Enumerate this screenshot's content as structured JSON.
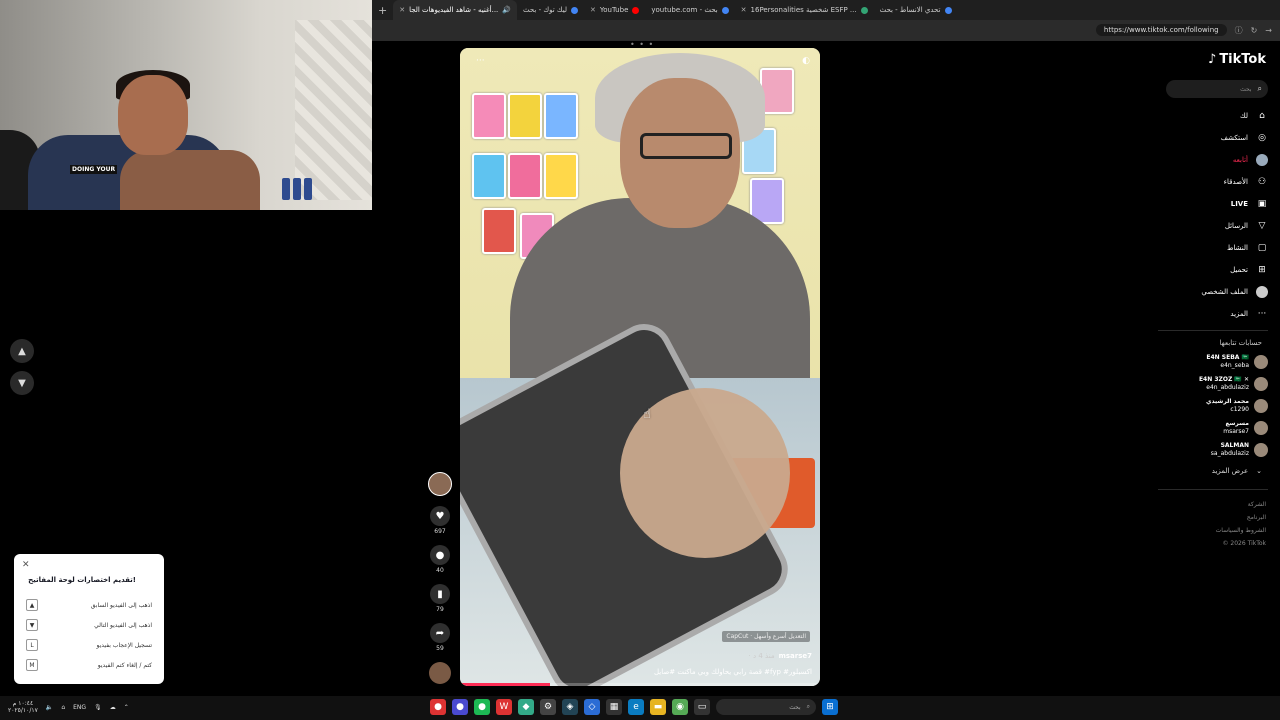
{
  "browser": {
    "tabs": [
      {
        "label": "أغنيه - شاهد الفيديوهات الجا...",
        "active": true,
        "color": "#888888"
      },
      {
        "label": "ليك توك - بحث",
        "active": false,
        "color": "#4285f4"
      },
      {
        "label": "YouTube",
        "active": false,
        "color": "#ff0000"
      },
      {
        "label": "youtube.com - بحث",
        "active": false,
        "color": "#4285f4"
      },
      {
        "label": "16Personalities شخصية ESFP ...",
        "active": false,
        "color": "#33a474"
      },
      {
        "label": "تحدي الانساط - بحث",
        "active": false,
        "color": "#4285f4"
      }
    ],
    "new_tab": "+",
    "url": "https://www.tiktok.com/following"
  },
  "tiktok": {
    "logo": "TikTok",
    "search_placeholder": "بحث",
    "nav": [
      {
        "label": "لك",
        "icon": "home-icon",
        "glyph": "⌂"
      },
      {
        "label": "استكشف",
        "icon": "compass-icon",
        "glyph": "◎"
      },
      {
        "label": "أتابعه",
        "icon": "following-icon",
        "glyph": "●",
        "active": true
      },
      {
        "label": "الأصدقاء",
        "icon": "friends-icon",
        "glyph": "👥"
      },
      {
        "label": "LIVE",
        "icon": "live-icon",
        "glyph": "▣",
        "bold": true
      },
      {
        "label": "الرسائل",
        "icon": "messages-icon",
        "glyph": "▽"
      },
      {
        "label": "النشاط",
        "icon": "activity-icon",
        "glyph": "▢"
      },
      {
        "label": "تحميل",
        "icon": "upload-icon",
        "glyph": "⊞"
      },
      {
        "label": "الملف الشخصي",
        "icon": "profile-icon",
        "glyph": "●"
      },
      {
        "label": "المزيد",
        "icon": "more-icon",
        "glyph": "···"
      }
    ],
    "following_title": "حسابات تتابعها",
    "following": [
      {
        "name": "E4N SEBA 🇸🇦",
        "handle": "e4n_seba"
      },
      {
        "name": "E4N 3ZOZ 🇸🇦 ✕",
        "handle": "e4n_abdulaziz"
      },
      {
        "name": "محمد الرشيدي",
        "handle": "c1290"
      },
      {
        "name": "مسرسع",
        "handle": "msarse7"
      },
      {
        "name": "SALMAN",
        "handle": "sa_abdulaziz"
      }
    ],
    "see_more": "عرض المزيد",
    "footer": [
      "الشركة",
      "البرنامج",
      "الشروط والسياسات",
      "© 2026 TikTok"
    ],
    "video": {
      "username": "msarse7",
      "date": "· منذ 4 د",
      "description": "قصة رابي يحاولك وبي ماكنت #صايل #fyp #اكسبلور",
      "capcut": "CapCut · التعديل أسرع وأسهل",
      "progress": 0.25
    },
    "actions": {
      "likes": "697",
      "comments": "40",
      "saves": "79",
      "shares": "59"
    }
  },
  "shortcuts": {
    "title": "تقديم اختصارات لوحة المفاتيح!",
    "items": [
      {
        "key": "▲",
        "label": "اذهب إلى الفيديو السابق"
      },
      {
        "key": "▼",
        "label": "اذهب إلى الفيديو التالي"
      },
      {
        "key": "L",
        "label": "تسجيل الإعجاب بفيديو"
      },
      {
        "key": "M",
        "label": "كتم / إلغاء كتم الفيديو"
      }
    ]
  },
  "webcam": {
    "shirt_text": "DOING YOUR"
  },
  "taskbar": {
    "time": "١٠:٤٤ م",
    "date": "٢٠٢٥/١٠/١٧",
    "lang": "ENG",
    "search_placeholder": "بحث"
  }
}
